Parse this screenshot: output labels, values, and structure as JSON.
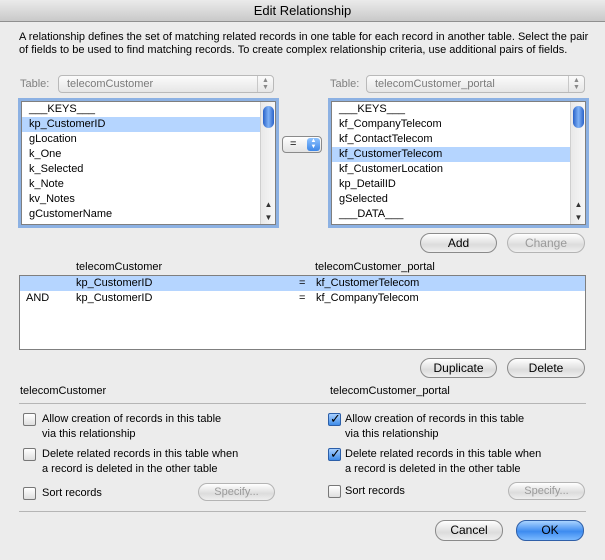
{
  "window": {
    "title": "Edit Relationship"
  },
  "description": "A relationship defines the set of matching related records in one table for each record in another table. Select the pair of fields to be used to find matching records. To create complex relationship criteria, use additional pairs of fields.",
  "left": {
    "table_label": "Table:",
    "table_value": "telecomCustomer",
    "fields": [
      "___KEYS___",
      "kp_CustomerID",
      "gLocation",
      "k_One",
      "k_Selected",
      "k_Note",
      "kv_Notes",
      "gCustomerName"
    ],
    "selected_index": 1
  },
  "right": {
    "table_label": "Table:",
    "table_value": "telecomCustomer_portal",
    "fields": [
      "___KEYS___",
      "kf_CompanyTelecom",
      "kf_ContactTelecom",
      "kf_CustomerTelecom",
      "kf_CustomerLocation",
      "kp_DetailID",
      "gSelected",
      "___DATA___"
    ],
    "selected_index": 3
  },
  "operator": "=",
  "buttons": {
    "add": "Add",
    "change": "Change",
    "duplicate": "Duplicate",
    "delete": "Delete",
    "specify_left": "Specify...",
    "specify_right": "Specify...",
    "cancel": "Cancel",
    "ok": "OK"
  },
  "criteria": {
    "left_header": "telecomCustomer",
    "right_header": "telecomCustomer_portal",
    "rows": [
      {
        "conj": "",
        "left": "kp_CustomerID",
        "op": "=",
        "right": "kf_CustomerTelecom",
        "selected": true
      },
      {
        "conj": "AND",
        "left": "kp_CustomerID",
        "op": "=",
        "right": "kf_CompanyTelecom",
        "selected": false
      }
    ]
  },
  "options": {
    "left_title": "telecomCustomer",
    "right_title": "telecomCustomer_portal",
    "allow_line1": "Allow creation of records in this table",
    "allow_line2": "via this relationship",
    "delete_line1": "Delete related records in this table when",
    "delete_line2": "a record is deleted in the other table",
    "sort": "Sort records",
    "left_allow": false,
    "left_delete": false,
    "left_sort": false,
    "right_allow": true,
    "right_delete": true,
    "right_sort": false
  }
}
